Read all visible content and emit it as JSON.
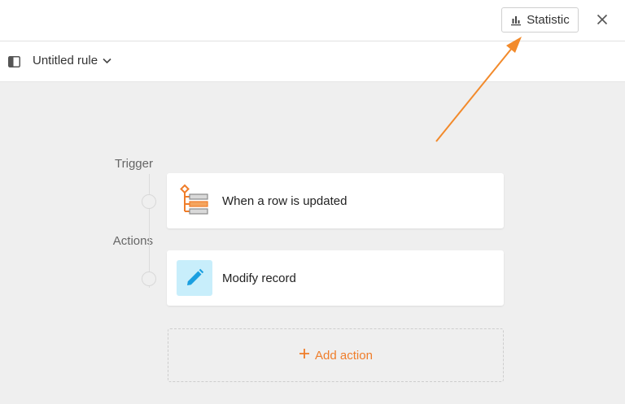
{
  "header": {
    "statistic_label": "Statistic",
    "statistic_icon": "bar-chart-icon",
    "close_icon": "close-icon"
  },
  "rule": {
    "title": "Untitled rule",
    "panel_icon": "sidebar-panel-icon",
    "dropdown_icon": "chevron-down-icon"
  },
  "workflow": {
    "trigger_label": "Trigger",
    "actions_label": "Actions",
    "trigger": {
      "label": "When a row is updated",
      "icon": "row-updated-icon"
    },
    "actions": [
      {
        "label": "Modify record",
        "icon": "pencil-icon"
      }
    ],
    "add_action_label": "Add action",
    "add_action_icon": "plus-icon"
  },
  "colors": {
    "accent": "#ef7d2a",
    "annotation_arrow": "#f28a2b",
    "modify_icon_bg": "#c8eefb",
    "modify_icon_fg": "#1a9fe0"
  }
}
